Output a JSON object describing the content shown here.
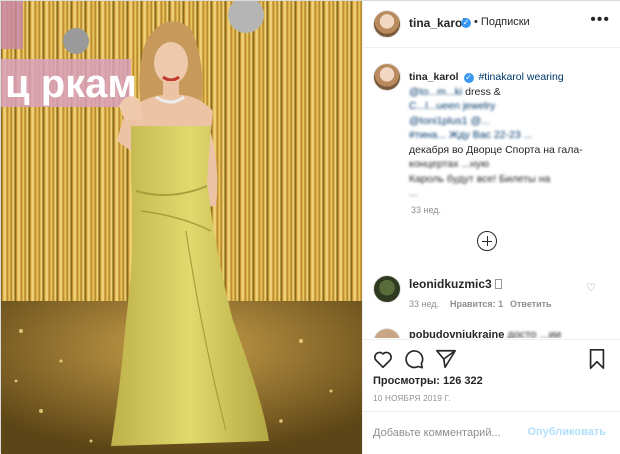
{
  "header": {
    "username": "tina_karol",
    "verified_glyph": "✓",
    "follow_label": "• Подписки",
    "more_label": "•••"
  },
  "caption": {
    "username": "tina_karol",
    "line1": "#tinakarol wearing",
    "line2_tag": "@to...m...ki",
    "line2_rest": " dress &",
    "line3": "C...l...ueen jewelry",
    "line4": "@toni1plus1 @...",
    "line5": "#тина... Жду Вас 22-23 ...",
    "line6": "декабря во Дворце Спорта на гала-",
    "line7": "концертах ...ную",
    "line8": "Кароль будут все! Билеты на",
    "line9": "...",
    "time": "33 нед."
  },
  "comments": [
    {
      "username": "leonidkuzmic3",
      "time": "33 нед.",
      "likes": "Нравится: 1",
      "reply": "Ответить"
    },
    {
      "username": "pobudovniukraine",
      "text": " досто ...ии"
    }
  ],
  "stats": {
    "views": "Просмотры: 126 322",
    "date": "10 НОЯБРЯ 2019 Г."
  },
  "composer": {
    "placeholder": "Добавьте комментарий...",
    "publish_label": "Опубликовать"
  },
  "media": {
    "sign_text": "ц   ркам"
  },
  "colors": {
    "link": "#00376b",
    "publish_disabled": "#b2dffc",
    "verified": "#3897f0",
    "dress": "#d8cf5f"
  }
}
